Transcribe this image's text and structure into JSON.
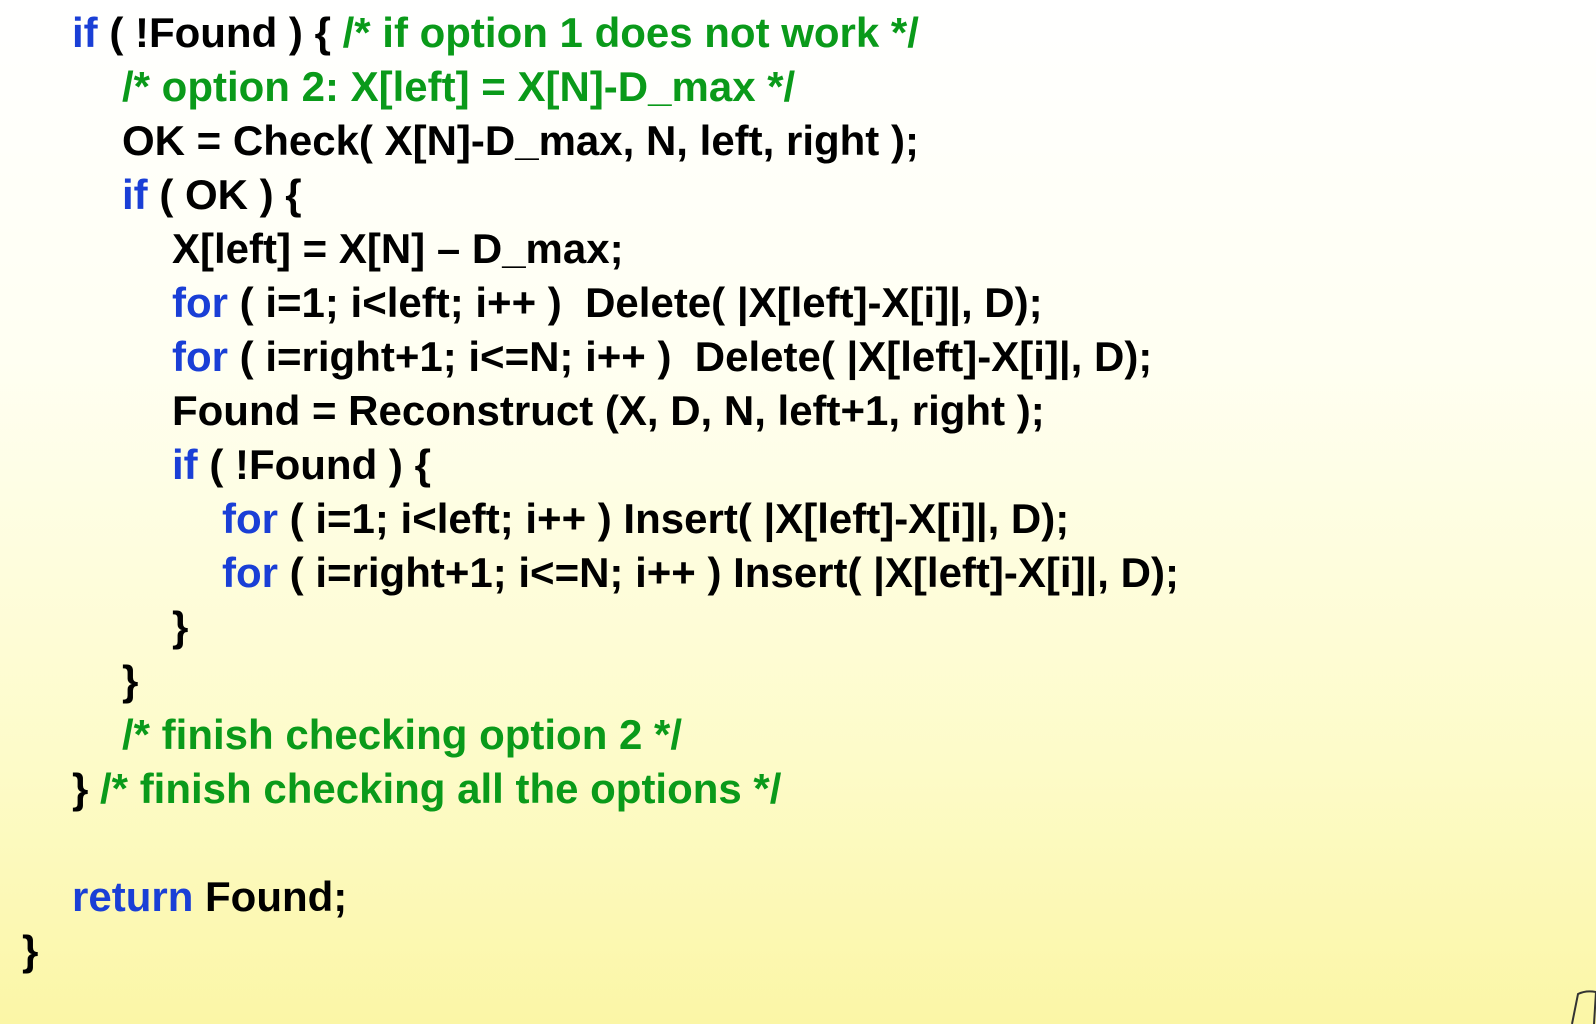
{
  "lines": [
    {
      "indent": 1,
      "parts": [
        {
          "t": "kw",
          "s": "if"
        },
        {
          "t": "pl",
          "s": " ( !Found ) { "
        },
        {
          "t": "cm",
          "s": "/* if option 1 does not work */"
        }
      ]
    },
    {
      "indent": 2,
      "parts": [
        {
          "t": "cm",
          "s": "/* option 2: X[left] = X[N]-D_max */"
        }
      ]
    },
    {
      "indent": 2,
      "parts": [
        {
          "t": "pl",
          "s": "OK = Check( X[N]-D_max, N, left, right );"
        }
      ]
    },
    {
      "indent": 2,
      "parts": [
        {
          "t": "kw",
          "s": "if"
        },
        {
          "t": "pl",
          "s": " ( OK ) {"
        }
      ]
    },
    {
      "indent": 3,
      "parts": [
        {
          "t": "pl",
          "s": "X[left] = X[N] – D_max;"
        }
      ]
    },
    {
      "indent": 3,
      "parts": [
        {
          "t": "kw",
          "s": "for"
        },
        {
          "t": "pl",
          "s": " ( i=1; i<left; i++ )  Delete( |X[left]-X[i]|, D);"
        }
      ]
    },
    {
      "indent": 3,
      "parts": [
        {
          "t": "kw",
          "s": "for"
        },
        {
          "t": "pl",
          "s": " ( i=right+1; i<=N; i++ )  Delete( |X[left]-X[i]|, D);"
        }
      ]
    },
    {
      "indent": 3,
      "parts": [
        {
          "t": "pl",
          "s": "Found = Reconstruct (X, D, N, left+1, right );"
        }
      ]
    },
    {
      "indent": 3,
      "parts": [
        {
          "t": "kw",
          "s": "if"
        },
        {
          "t": "pl",
          "s": " ( !Found ) {"
        }
      ]
    },
    {
      "indent": 4,
      "parts": [
        {
          "t": "kw",
          "s": "for"
        },
        {
          "t": "pl",
          "s": " ( i=1; i<left; i++ ) Insert( |X[left]-X[i]|, D);"
        }
      ]
    },
    {
      "indent": 4,
      "parts": [
        {
          "t": "kw",
          "s": "for"
        },
        {
          "t": "pl",
          "s": " ( i=right+1; i<=N; i++ ) Insert( |X[left]-X[i]|, D);"
        }
      ]
    },
    {
      "indent": 3,
      "parts": [
        {
          "t": "pl",
          "s": "}"
        }
      ]
    },
    {
      "indent": 2,
      "parts": [
        {
          "t": "pl",
          "s": "}"
        }
      ]
    },
    {
      "indent": 2,
      "parts": [
        {
          "t": "cm",
          "s": "/* finish checking option 2 */"
        }
      ]
    },
    {
      "indent": 1,
      "parts": [
        {
          "t": "pl",
          "s": "} "
        },
        {
          "t": "cm",
          "s": "/* finish checking all the options */"
        }
      ]
    },
    {
      "indent": 1,
      "blank": true,
      "parts": []
    },
    {
      "indent": 1,
      "parts": [
        {
          "t": "kw",
          "s": "return"
        },
        {
          "t": "pl",
          "s": " Found;"
        }
      ]
    },
    {
      "indent": 0,
      "parts": [
        {
          "t": "pl",
          "s": "}"
        }
      ]
    }
  ],
  "colors": {
    "keyword": "#1a3fd6",
    "comment": "#0a9a1a",
    "plain": "#000000"
  }
}
